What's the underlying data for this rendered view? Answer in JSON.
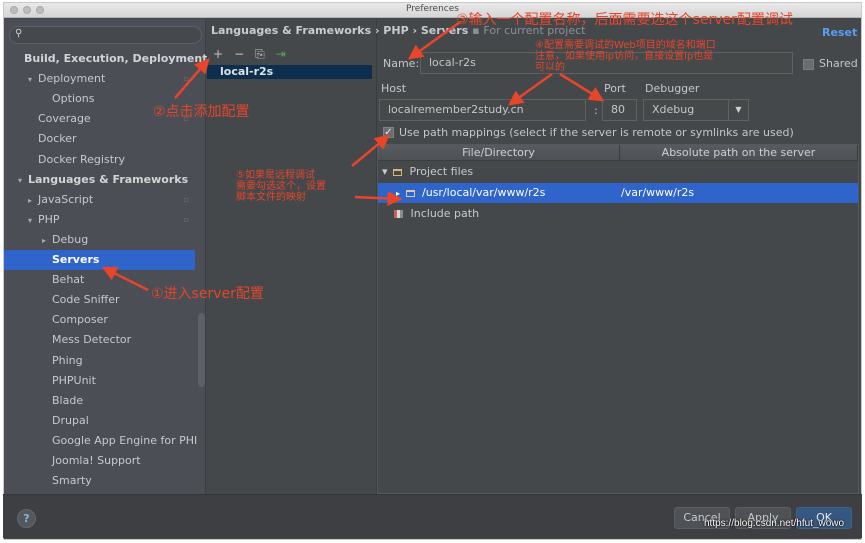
{
  "window": {
    "title": "Preferences"
  },
  "sidebar": {
    "search_placeholder": "",
    "items": [
      {
        "label": "Build, Execution, Deployment",
        "arrow": "",
        "level": 0,
        "bold": true
      },
      {
        "label": "Deployment",
        "arrow": "▾",
        "level": 1,
        "project": true
      },
      {
        "label": "Options",
        "arrow": "",
        "level": 2
      },
      {
        "label": "Coverage",
        "arrow": "",
        "level": 1,
        "project": true
      },
      {
        "label": "Docker",
        "arrow": "",
        "level": 1
      },
      {
        "label": "Docker Registry",
        "arrow": "",
        "level": 1
      },
      {
        "label": "Languages & Frameworks",
        "arrow": "▾",
        "level": 0,
        "bold": true
      },
      {
        "label": "JavaScript",
        "arrow": "▸",
        "level": 1,
        "project": true
      },
      {
        "label": "PHP",
        "arrow": "▾",
        "level": 1,
        "project": true
      },
      {
        "label": "Debug",
        "arrow": "▸",
        "level": 2
      },
      {
        "label": "Servers",
        "arrow": "",
        "level": 2,
        "selected": true
      },
      {
        "label": "Behat",
        "arrow": "",
        "level": 2
      },
      {
        "label": "Code Sniffer",
        "arrow": "",
        "level": 2
      },
      {
        "label": "Composer",
        "arrow": "",
        "level": 2
      },
      {
        "label": "Mess Detector",
        "arrow": "",
        "level": 2
      },
      {
        "label": "Phing",
        "arrow": "",
        "level": 2
      },
      {
        "label": "PHPUnit",
        "arrow": "",
        "level": 2
      },
      {
        "label": "Blade",
        "arrow": "",
        "level": 2
      },
      {
        "label": "Drupal",
        "arrow": "",
        "level": 2
      },
      {
        "label": "Google App Engine for PHI",
        "arrow": "",
        "level": 2
      },
      {
        "label": "Joomla! Support",
        "arrow": "",
        "level": 2
      },
      {
        "label": "Smarty",
        "arrow": "",
        "level": 2
      }
    ]
  },
  "header": {
    "breadcrumb": "Languages & Frameworks › PHP › Servers",
    "breadcrumb_sub": "For current project",
    "reset_label": "Reset"
  },
  "toolbar": {
    "add": "+",
    "remove": "−",
    "copy": "⎘",
    "import": "⇥"
  },
  "servers": [
    {
      "name": "local-r2s",
      "selected": true
    }
  ],
  "form": {
    "name_label": "Name:",
    "name_value": "local-r2s",
    "shared_label": "Shared",
    "shared_checked": false,
    "host_label": "Host",
    "host_value": "localremember2study.cn",
    "port_label": "Port",
    "port_value": "80",
    "colon": ":",
    "debugger_label": "Debugger",
    "debugger_value": "Xdebug",
    "use_path_mappings_label": "Use path mappings (select if the server is remote or symlinks are used)",
    "use_path_mappings_checked": true
  },
  "mappings": {
    "columns": [
      "File/Directory",
      "Absolute path on the server"
    ],
    "rows": [
      {
        "label": "Project files",
        "arrow": "▾",
        "icon": "folder",
        "server_path": ""
      },
      {
        "label": "/usr/local/var/www/r2s",
        "arrow": "▸",
        "icon": "folder",
        "server_path": "/var/www/r2s",
        "selected": true
      },
      {
        "label": "Include path",
        "arrow": "",
        "icon": "library",
        "server_path": ""
      }
    ]
  },
  "footer": {
    "help": "?",
    "cancel_label": "Cancel",
    "apply_label": "Apply",
    "ok_label": "OK"
  },
  "annotations": {
    "step1": "①进入server配置",
    "step2": "②点击添加配置",
    "step3": "③输入一个配置名称，后面需要选这个server配置调试",
    "step4_line1": "④配置需要调试的Web项目的域名和端口",
    "step4_line2": "注意，如果使用ip访问，直接设置ip也是",
    "step4_line3": "可以的",
    "step5_line1": "⑤如果是远程调试",
    "step5_line2": "需要勾选这个，设置",
    "step5_line3": "脚本文件的映射"
  },
  "watermark": "https://blog.csdn.net/hfut_wowo",
  "colors": {
    "accent": "#2f65ca",
    "annotation": "#e8452a",
    "link": "#589df6",
    "ok_button": "#365880"
  }
}
